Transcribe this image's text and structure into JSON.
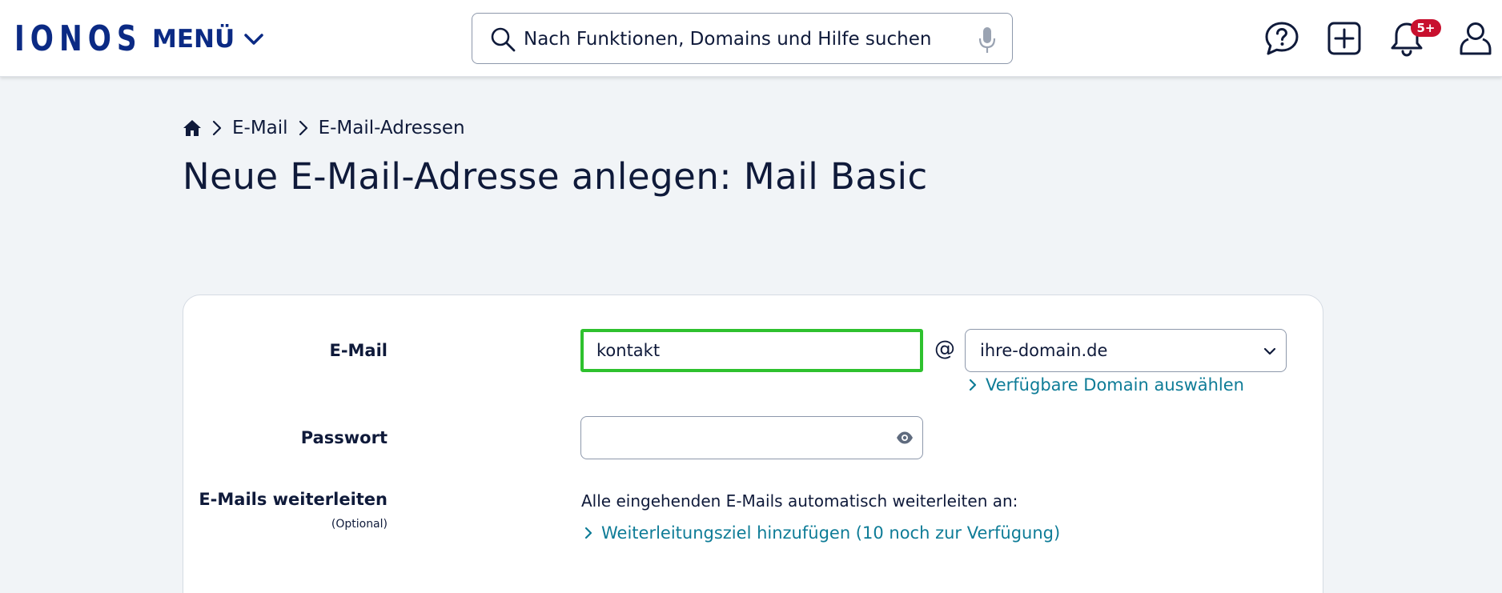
{
  "header": {
    "logo_text": "IONOS",
    "menu_label": "MENÜ",
    "search_placeholder": "Nach Funktionen, Domains und Hilfe suchen",
    "notification_badge": "5+",
    "icons": [
      "search-icon",
      "microphone-icon",
      "help-chat-icon",
      "add-icon",
      "bell-icon",
      "user-icon"
    ]
  },
  "breadcrumb": {
    "items": [
      "E-Mail",
      "E-Mail-Adressen"
    ]
  },
  "page_title": "Neue E-Mail-Adresse anlegen: Mail Basic",
  "form": {
    "email_label": "E-Mail",
    "email_value": "kontakt",
    "at_sign": "@",
    "domain_value": "ihre-domain.de",
    "domain_link": "Verfügbare Domain auswählen",
    "password_label": "Passwort",
    "password_value": "",
    "forward_label": "E-Mails weiterleiten",
    "forward_optional": "(Optional)",
    "forward_text": "Alle eingehenden E-Mails automatisch weiterleiten an:",
    "forward_link": "Weiterleitungsziel hinzufügen (10 noch zur Verfügung)"
  },
  "colors": {
    "brand": "#0b2a84",
    "text": "#0f1a3a",
    "link": "#0e7c97",
    "focus_border": "#2ec12e",
    "badge": "#c8102e",
    "page_bg": "#f1f4f7"
  }
}
